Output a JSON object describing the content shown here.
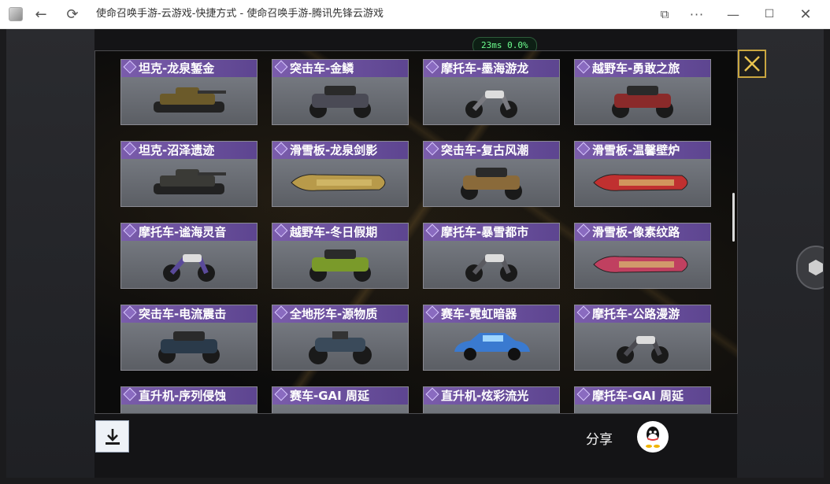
{
  "window": {
    "title": "使命召唤手游-云游戏-快捷方式 - 使命召唤手游-腾讯先锋云游戏",
    "icons": {
      "app": "app-icon",
      "back": "arrow-left-icon",
      "refresh": "refresh-icon",
      "share": "share-window-icon",
      "more": "more-dots-icon",
      "minimize": "minimize-icon",
      "maximize": "maximize-icon",
      "close": "close-icon"
    },
    "glyphs": {
      "back": "←",
      "refresh": "⟳",
      "share": "⧉",
      "more": "···",
      "minimize": "—",
      "maximize": "☐",
      "close": "✕"
    }
  },
  "stats": {
    "latency": "23ms",
    "loss": "0.0%"
  },
  "items": [
    [
      "坦克-龙泉錾金",
      "突击车-金鳞",
      "摩托车-墨海游龙",
      "越野车-勇敢之旅"
    ],
    [
      "坦克-沼泽遗迹",
      "滑雪板-龙泉剑影",
      "突击车-复古风潮",
      "滑雪板-温馨壁炉"
    ],
    [
      "摩托车-谧海灵音",
      "越野车-冬日假期",
      "摩托车-暴雪都市",
      "滑雪板-像素纹路"
    ],
    [
      "突击车-电流震击",
      "全地形车-源物质",
      "赛车-霓虹暗器",
      "摩托车-公路漫游"
    ],
    [
      "直升机-序列侵蚀",
      "赛车-GAI 周延",
      "直升机-炫彩流光",
      "摩托车-GAI 周延"
    ]
  ],
  "share_label": "分享",
  "buttons": {
    "download": "download-icon",
    "qq": "qq-icon",
    "close_panel": "close-x-icon"
  },
  "colors": {
    "header_purple": "#6b4fa0",
    "close_gold": "#c9a640",
    "stat_green": "#6dff8f"
  }
}
